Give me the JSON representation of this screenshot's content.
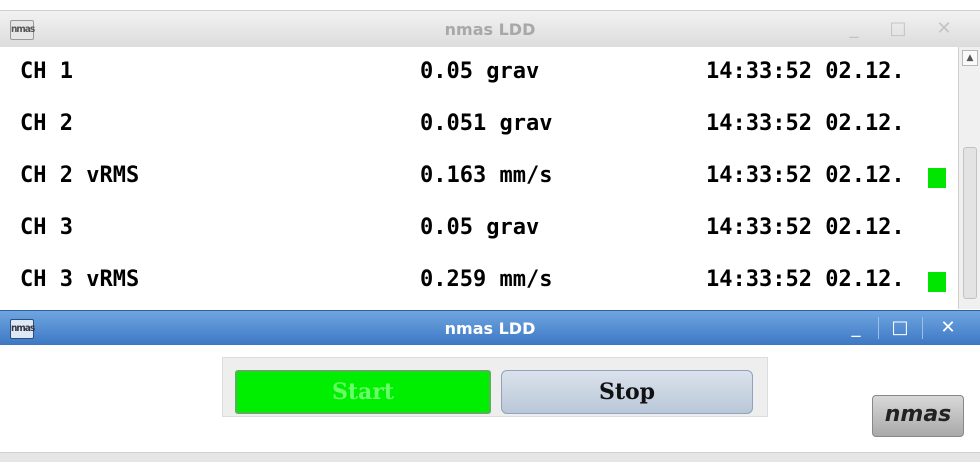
{
  "window1": {
    "title": "nmas LDD",
    "app_icon": "nmas",
    "controls": {
      "minimize": "_",
      "maximize": "□",
      "close": "✕"
    },
    "rows": [
      {
        "name": "CH 1",
        "value": "0.05 grav",
        "time": "14:33:52 02.12.",
        "indicator": false
      },
      {
        "name": "CH 2",
        "value": "0.051 grav",
        "time": "14:33:52 02.12.",
        "indicator": false
      },
      {
        "name": "CH 2 vRMS",
        "value": "0.163 mm/s",
        "time": "14:33:52 02.12.",
        "indicator": true
      },
      {
        "name": "CH 3",
        "value": "0.05 grav",
        "time": "14:33:52 02.12.",
        "indicator": false
      },
      {
        "name": "CH 3 vRMS",
        "value": "0.259 mm/s",
        "time": "14:33:52 02.12.",
        "indicator": true
      }
    ],
    "indicator_color": "#00e600",
    "scroll_up_icon": "▲"
  },
  "window2": {
    "title": "nmas LDD",
    "app_icon": "nmas",
    "controls": {
      "minimize": "_",
      "maximize": "□",
      "close": "✕"
    },
    "start_label": "Start",
    "stop_label": "Stop",
    "start_color": "#00ee00",
    "logo_text": "nmas"
  }
}
